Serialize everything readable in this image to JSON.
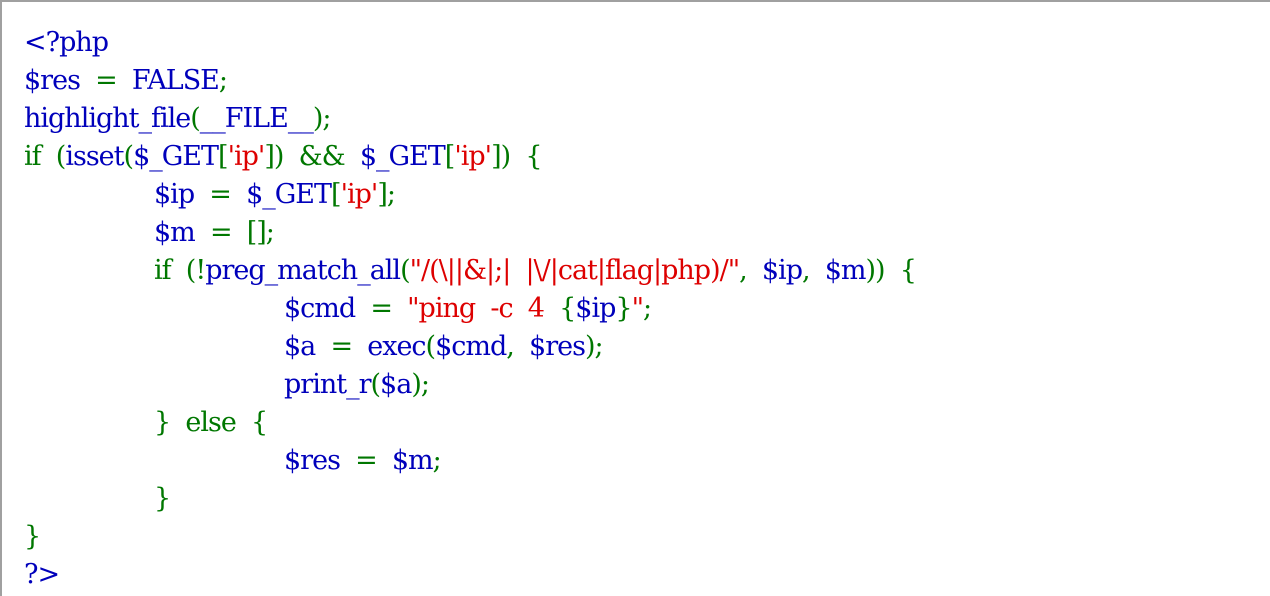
{
  "colors": {
    "html": "#000bb0",
    "default": "#0000bb",
    "keyword": "#007700",
    "string": "#dd0000",
    "background": "#ffffff",
    "border": "#a0a0a0"
  },
  "lines": [
    {
      "indent": 0,
      "tokens": [
        {
          "t": "<?php",
          "c": "default"
        }
      ]
    },
    {
      "indent": 0,
      "tokens": [
        {
          "t": "$res",
          "c": "default"
        },
        {
          "t": "  =  ",
          "c": "keyword"
        },
        {
          "t": "FALSE",
          "c": "default"
        },
        {
          "t": ";",
          "c": "keyword"
        }
      ]
    },
    {
      "indent": 0,
      "tokens": [
        {
          "t": "highlight_file",
          "c": "default"
        },
        {
          "t": "(",
          "c": "keyword"
        },
        {
          "t": "__FILE__",
          "c": "default"
        },
        {
          "t": ");",
          "c": "keyword"
        }
      ]
    },
    {
      "indent": 0,
      "tokens": [
        {
          "t": "if  (",
          "c": "keyword"
        },
        {
          "t": "isset",
          "c": "default"
        },
        {
          "t": "(",
          "c": "keyword"
        },
        {
          "t": "$_GET",
          "c": "default"
        },
        {
          "t": "[",
          "c": "keyword"
        },
        {
          "t": "'ip'",
          "c": "string"
        },
        {
          "t": "])  &&  ",
          "c": "keyword"
        },
        {
          "t": "$_GET",
          "c": "default"
        },
        {
          "t": "[",
          "c": "keyword"
        },
        {
          "t": "'ip'",
          "c": "string"
        },
        {
          "t": "])  {",
          "c": "keyword"
        }
      ]
    },
    {
      "indent": 1,
      "tokens": [
        {
          "t": "$ip",
          "c": "default"
        },
        {
          "t": "  =  ",
          "c": "keyword"
        },
        {
          "t": "$_GET",
          "c": "default"
        },
        {
          "t": "[",
          "c": "keyword"
        },
        {
          "t": "'ip'",
          "c": "string"
        },
        {
          "t": "];",
          "c": "keyword"
        }
      ]
    },
    {
      "indent": 1,
      "tokens": [
        {
          "t": "$m",
          "c": "default"
        },
        {
          "t": "  =  [];",
          "c": "keyword"
        }
      ]
    },
    {
      "indent": 1,
      "tokens": [
        {
          "t": "if  (!",
          "c": "keyword"
        },
        {
          "t": "preg_match_all",
          "c": "default"
        },
        {
          "t": "(",
          "c": "keyword"
        },
        {
          "t": "\"/(\\||&|;|  |\\/|cat|flag|php)/\"",
          "c": "string"
        },
        {
          "t": ",  ",
          "c": "keyword"
        },
        {
          "t": "$ip",
          "c": "default"
        },
        {
          "t": ",  ",
          "c": "keyword"
        },
        {
          "t": "$m",
          "c": "default"
        },
        {
          "t": "))  {",
          "c": "keyword"
        }
      ]
    },
    {
      "indent": 2,
      "tokens": [
        {
          "t": "$cmd",
          "c": "default"
        },
        {
          "t": "  =  ",
          "c": "keyword"
        },
        {
          "t": "\"ping  -c  4  ",
          "c": "string"
        },
        {
          "t": "{",
          "c": "keyword"
        },
        {
          "t": "$ip",
          "c": "default"
        },
        {
          "t": "}",
          "c": "keyword"
        },
        {
          "t": "\"",
          "c": "string"
        },
        {
          "t": ";",
          "c": "keyword"
        }
      ]
    },
    {
      "indent": 2,
      "tokens": [
        {
          "t": "$a",
          "c": "default"
        },
        {
          "t": "  =  ",
          "c": "keyword"
        },
        {
          "t": "exec",
          "c": "default"
        },
        {
          "t": "(",
          "c": "keyword"
        },
        {
          "t": "$cmd",
          "c": "default"
        },
        {
          "t": ",  ",
          "c": "keyword"
        },
        {
          "t": "$res",
          "c": "default"
        },
        {
          "t": ");",
          "c": "keyword"
        }
      ]
    },
    {
      "indent": 2,
      "tokens": [
        {
          "t": "print_r",
          "c": "default"
        },
        {
          "t": "(",
          "c": "keyword"
        },
        {
          "t": "$a",
          "c": "default"
        },
        {
          "t": ");",
          "c": "keyword"
        }
      ]
    },
    {
      "indent": 1,
      "tokens": [
        {
          "t": "}  else  {",
          "c": "keyword"
        }
      ]
    },
    {
      "indent": 2,
      "tokens": [
        {
          "t": "$res",
          "c": "default"
        },
        {
          "t": "  =  ",
          "c": "keyword"
        },
        {
          "t": "$m",
          "c": "default"
        },
        {
          "t": ";",
          "c": "keyword"
        }
      ]
    },
    {
      "indent": 1,
      "tokens": [
        {
          "t": "}",
          "c": "keyword"
        }
      ]
    },
    {
      "indent": 0,
      "tokens": [
        {
          "t": "}",
          "c": "keyword"
        }
      ]
    },
    {
      "indent": 0,
      "tokens": [
        {
          "t": "?>",
          "c": "default"
        }
      ]
    }
  ]
}
